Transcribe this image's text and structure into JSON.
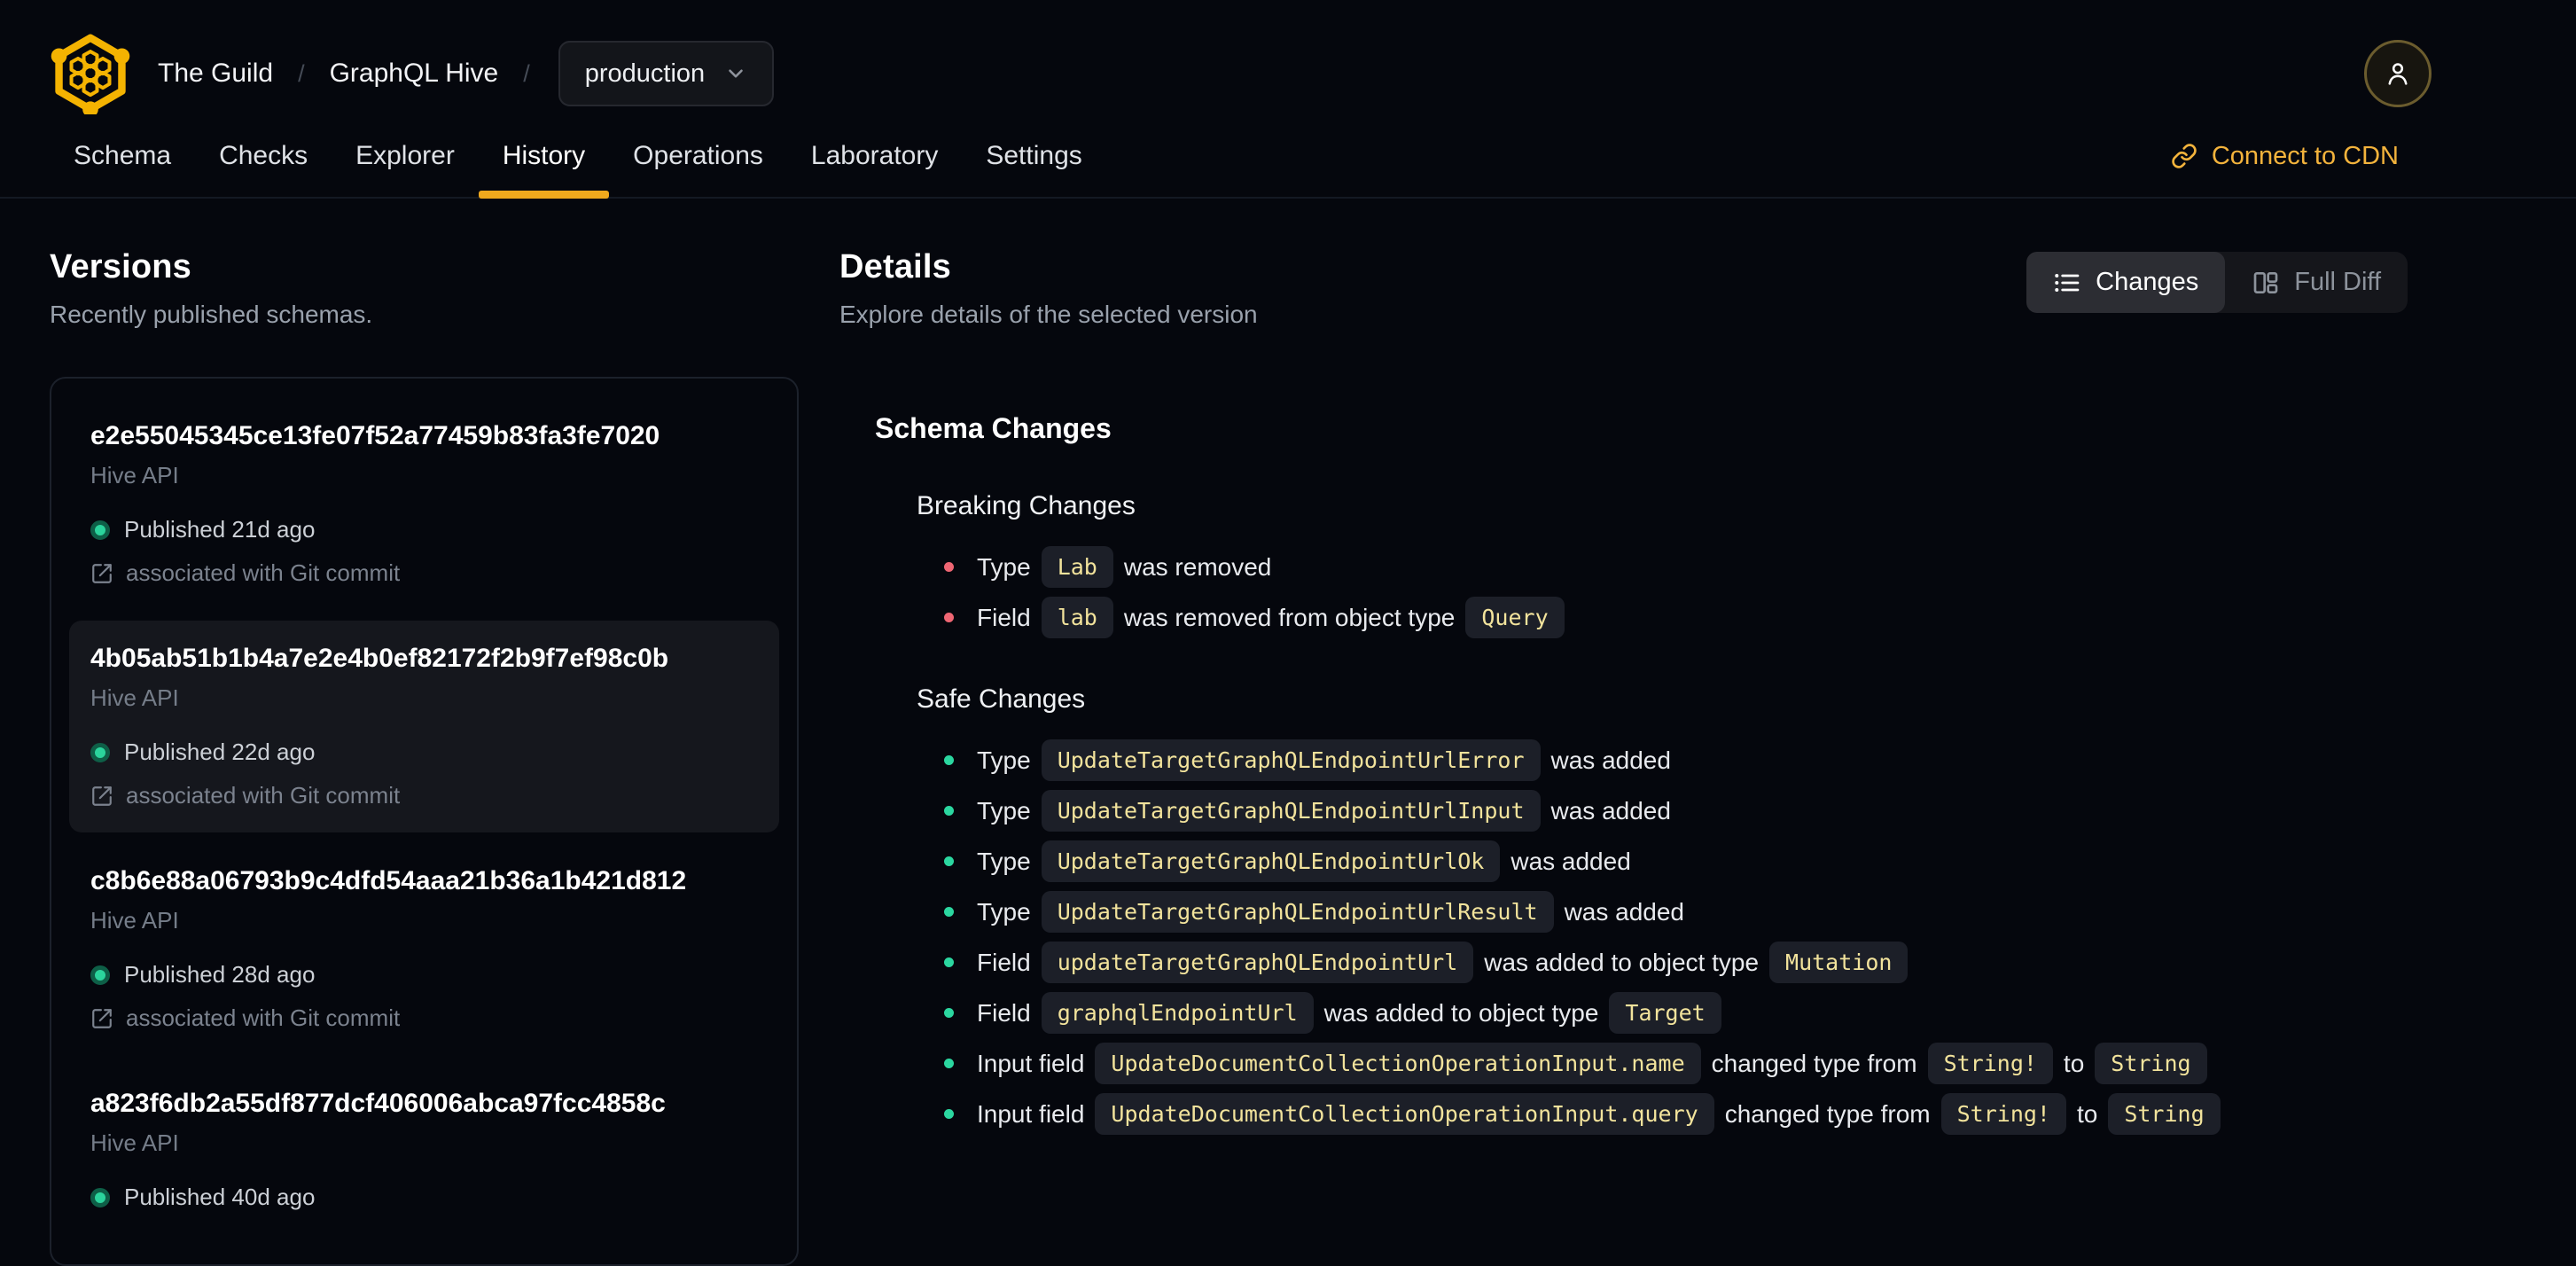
{
  "header": {
    "breadcrumb": {
      "org": "The Guild",
      "separator": "/",
      "project": "GraphQL Hive",
      "target": "production"
    },
    "tabs": [
      {
        "label": "Schema",
        "active": false
      },
      {
        "label": "Checks",
        "active": false
      },
      {
        "label": "Explorer",
        "active": false
      },
      {
        "label": "History",
        "active": true
      },
      {
        "label": "Operations",
        "active": false
      },
      {
        "label": "Laboratory",
        "active": false
      },
      {
        "label": "Settings",
        "active": false
      }
    ],
    "cdn": {
      "label": "Connect to CDN"
    }
  },
  "versions": {
    "title": "Versions",
    "subtitle": "Recently published schemas.",
    "items": [
      {
        "hash": "e2e55045345ce13fe07f52a77459b83fa3fe7020",
        "service": "Hive API",
        "published": "Published 21d ago",
        "commit": "associated with Git commit",
        "selected": false
      },
      {
        "hash": "4b05ab51b1b4a7e2e4b0ef82172f2b9f7ef98c0b",
        "service": "Hive API",
        "published": "Published 22d ago",
        "commit": "associated with Git commit",
        "selected": true
      },
      {
        "hash": "c8b6e88a06793b9c4dfd54aaa21b36a1b421d812",
        "service": "Hive API",
        "published": "Published 28d ago",
        "commit": "associated with Git commit",
        "selected": false
      },
      {
        "hash": "a823f6db2a55df877dcf406006abca97fcc4858c",
        "service": "Hive API",
        "published": "Published 40d ago",
        "commit": null,
        "selected": false
      }
    ]
  },
  "details": {
    "title": "Details",
    "subtitle": "Explore details of the selected version",
    "toggle": {
      "changes": "Changes",
      "full_diff": "Full Diff"
    },
    "section_title": "Schema Changes",
    "breaking": {
      "title": "Breaking Changes",
      "items": [
        [
          {
            "text": "Type"
          },
          {
            "code": "Lab"
          },
          {
            "text": "was removed"
          }
        ],
        [
          {
            "text": "Field"
          },
          {
            "code": "lab"
          },
          {
            "text": "was removed from object type"
          },
          {
            "code": "Query"
          }
        ]
      ]
    },
    "safe": {
      "title": "Safe Changes",
      "items": [
        [
          {
            "text": "Type"
          },
          {
            "code": "UpdateTargetGraphQLEndpointUrlError"
          },
          {
            "text": "was added"
          }
        ],
        [
          {
            "text": "Type"
          },
          {
            "code": "UpdateTargetGraphQLEndpointUrlInput"
          },
          {
            "text": "was added"
          }
        ],
        [
          {
            "text": "Type"
          },
          {
            "code": "UpdateTargetGraphQLEndpointUrlOk"
          },
          {
            "text": "was added"
          }
        ],
        [
          {
            "text": "Type"
          },
          {
            "code": "UpdateTargetGraphQLEndpointUrlResult"
          },
          {
            "text": "was added"
          }
        ],
        [
          {
            "text": "Field"
          },
          {
            "code": "updateTargetGraphQLEndpointUrl"
          },
          {
            "text": "was added to object type"
          },
          {
            "code": "Mutation"
          }
        ],
        [
          {
            "text": "Field"
          },
          {
            "code": "graphqlEndpointUrl"
          },
          {
            "text": "was added to object type"
          },
          {
            "code": "Target"
          }
        ],
        [
          {
            "text": "Input field"
          },
          {
            "code": "UpdateDocumentCollectionOperationInput.name"
          },
          {
            "text": "changed type from"
          },
          {
            "code": "String!"
          },
          {
            "text": "to"
          },
          {
            "code": "String"
          }
        ],
        [
          {
            "text": "Input field"
          },
          {
            "code": "UpdateDocumentCollectionOperationInput.query"
          },
          {
            "text": "changed type from"
          },
          {
            "code": "String!"
          },
          {
            "text": "to"
          },
          {
            "code": "String"
          }
        ]
      ]
    }
  },
  "colors": {
    "background": "#05070d",
    "accent_yellow": "#f0a81d",
    "cdn_link": "#f3b33c",
    "chip_background": "#1c1f28",
    "chip_text": "#f2e39c",
    "breaking_bullet": "#ef6673",
    "safe_bullet": "#2bd7a0",
    "published_dot": "#2bd49c"
  }
}
